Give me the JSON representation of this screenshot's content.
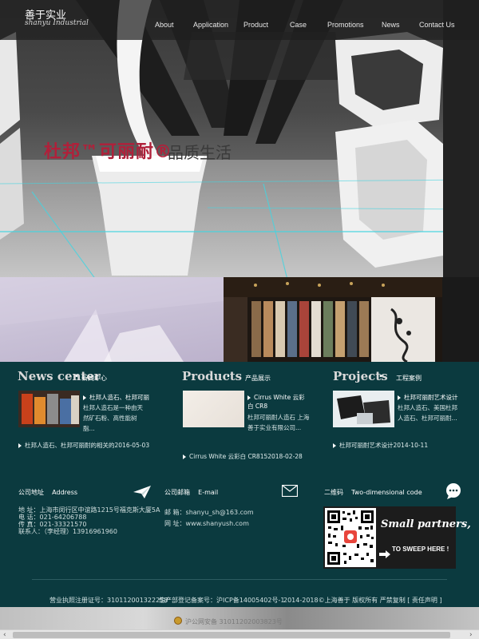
{
  "header": {
    "logo_cn": "善于实业",
    "logo_en": "shanyu Industrial",
    "nav": [
      "About",
      "Application",
      "Product",
      "Case",
      "Promotions",
      "News",
      "Contact Us"
    ]
  },
  "hero": {
    "tagline_brand": "杜邦™可丽耐®",
    "tagline_slogan": "品质生活"
  },
  "news": {
    "title": "News center",
    "subtitle": "新闻中心",
    "item_title": "杜邦人造石、杜邦可丽",
    "item_desc": "杜邦人造石是一种由天然矿石粉、高性能树脂...",
    "link": "杜邦人造石、杜邦可丽耐的相关的2016-05-03"
  },
  "products": {
    "title": "Products",
    "subtitle": "产品展示",
    "item_title": "Cirrus White 云彩白 CR8",
    "item_desc": "杜邦可丽耐人造石 上海善于实业有限公司...",
    "link": "Cirrus White 云彩白 CR8152018-02-28"
  },
  "projects": {
    "title": "Projects",
    "subtitle": "工程案例",
    "item_title": "杜邦可丽耐艺术设计",
    "item_desc": "杜邦人造石、美国杜邦人造石、杜邦可丽耐...",
    "link": "杜邦可丽耐艺术设计2014-10-11"
  },
  "address": {
    "label": "公司地址",
    "label_en": "Address",
    "lines": [
      "地 址：上海市闵行区中谊路1215号福克斯大厦5A",
      "电 话：021-64206788",
      "传 真：021-33321570",
      "联系人：（李经理）13916961960"
    ]
  },
  "email": {
    "label": "公司邮箱",
    "label_en": "E-mail",
    "lines": [
      "邮 箱：shanyu_sh@163.com",
      "网 址：www.shanyush.com"
    ]
  },
  "qrcode": {
    "label": "二维码",
    "label_en": "Two-dimensional code",
    "text1": "Small partners,",
    "text2": "TO SWEEP HERE !"
  },
  "footer": {
    "license": "营业执照注册证号：310112001322258",
    "icp": "信产部登记备案号：沪ICP备14005402号-1",
    "copyright": "2014-2018©上海善于 版权所有 严禁复制 [ 责任声明 ]",
    "police": "沪公网安备 31011202003823号"
  }
}
